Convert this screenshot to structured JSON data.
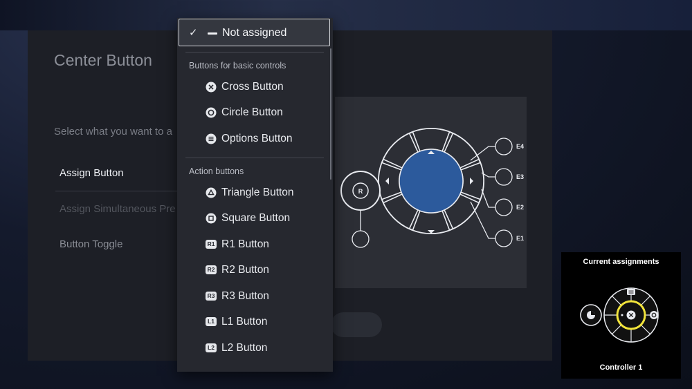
{
  "panel": {
    "title": "Center Button",
    "subtitle": "Select what you want to a",
    "options": [
      "Assign Button",
      "Assign Simultaneous Pre",
      "Button Toggle"
    ]
  },
  "dropdown": {
    "selected_label": "Not assigned",
    "groups": [
      {
        "title": "Buttons for basic controls",
        "items": [
          {
            "label": "Cross Button",
            "icon": "cross-icon"
          },
          {
            "label": "Circle Button",
            "icon": "circle-icon"
          },
          {
            "label": "Options Button",
            "icon": "options-icon"
          }
        ]
      },
      {
        "title": "Action buttons",
        "items": [
          {
            "label": "Triangle Button",
            "icon": "triangle-icon"
          },
          {
            "label": "Square Button",
            "icon": "square-icon"
          },
          {
            "label": "R1 Button",
            "icon": "r1-icon",
            "badge": "R1"
          },
          {
            "label": "R2 Button",
            "icon": "r2-icon",
            "badge": "R2"
          },
          {
            "label": "R3 Button",
            "icon": "r3-icon",
            "badge": "R3"
          },
          {
            "label": "L1 Button",
            "icon": "l1-icon",
            "badge": "L1"
          },
          {
            "label": "L2 Button",
            "icon": "l2-icon",
            "badge": "L2"
          }
        ]
      }
    ]
  },
  "diagram": {
    "stick_label": "R",
    "expansion_ports": [
      "E4",
      "E3",
      "E2",
      "E1"
    ]
  },
  "assignments": {
    "title": "Current assignments",
    "controller": "Controller 1"
  },
  "colors": {
    "accent_blue": "#2c5a9c",
    "highlight_yellow": "#f2e43a",
    "panel": "#1d1f26",
    "dropdown": "#26282f"
  }
}
